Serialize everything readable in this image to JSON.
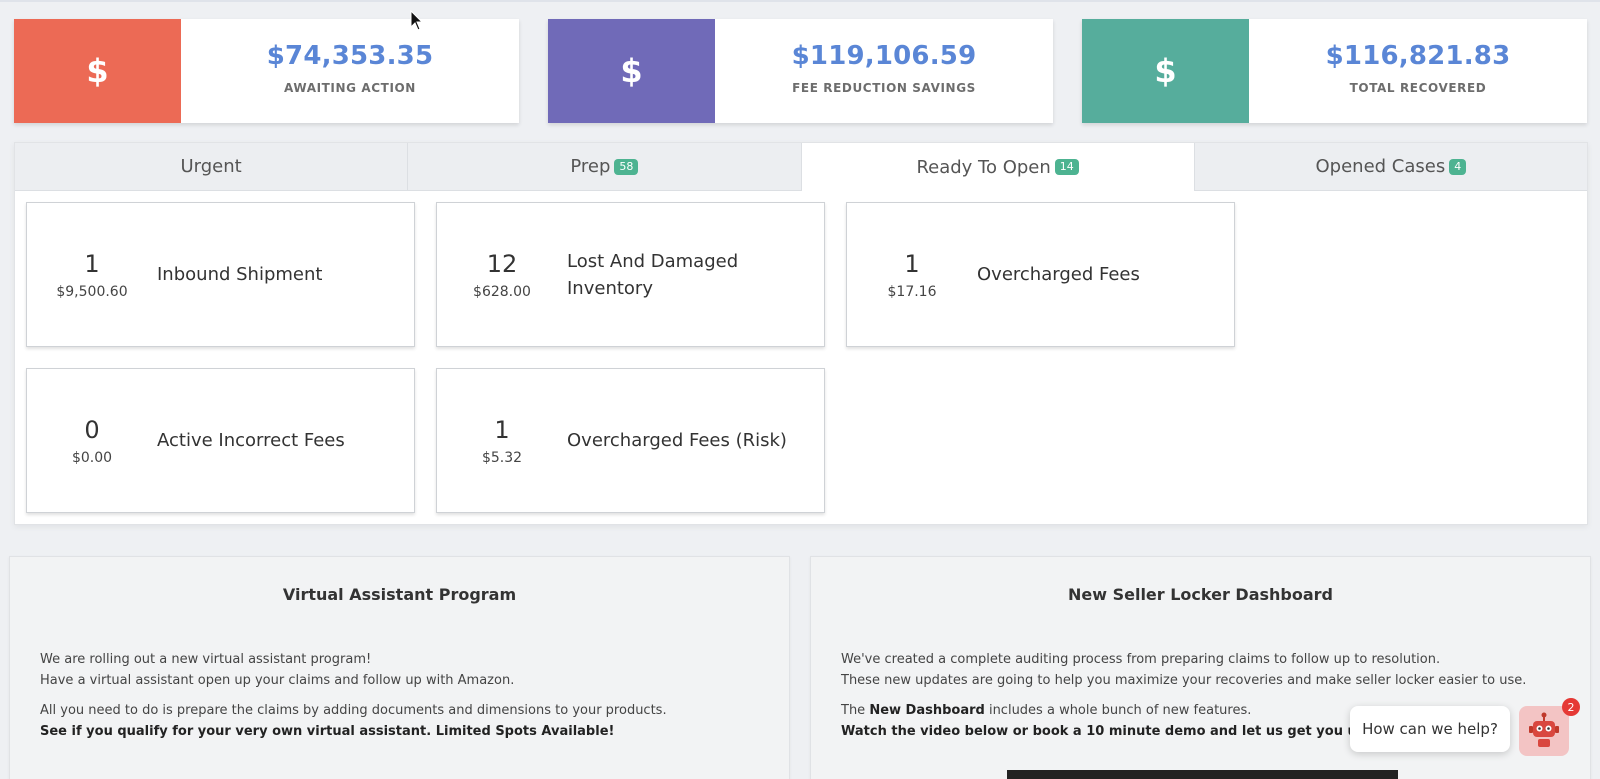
{
  "stats": [
    {
      "amount": "$74,353.35",
      "label": "AWAITING ACTION",
      "icon": "$",
      "color": "#ec6a55"
    },
    {
      "amount": "$119,106.59",
      "label": "FEE REDUCTION SAVINGS",
      "icon": "$",
      "color": "#706ab8"
    },
    {
      "amount": "$116,821.83",
      "label": "TOTAL RECOVERED",
      "icon": "$",
      "color": "#56ad9c"
    }
  ],
  "tabs": [
    {
      "label": "Urgent",
      "badge": ""
    },
    {
      "label": "Prep",
      "badge": "58"
    },
    {
      "label": "Ready To Open",
      "badge": "14"
    },
    {
      "label": "Opened Cases",
      "badge": "4"
    }
  ],
  "active_tab": "Ready To Open",
  "tiles": [
    {
      "count": "1",
      "amount": "$9,500.60",
      "label": "Inbound Shipment"
    },
    {
      "count": "12",
      "amount": "$628.00",
      "label": "Lost And Damaged Inventory"
    },
    {
      "count": "1",
      "amount": "$17.16",
      "label": "Overcharged Fees"
    },
    {
      "count": "0",
      "amount": "$0.00",
      "label": "Active Incorrect Fees"
    },
    {
      "count": "1",
      "amount": "$5.32",
      "label": "Overcharged Fees (Risk)"
    }
  ],
  "info_left": {
    "title": "Virtual Assistant Program",
    "line1": "We are rolling out a new virtual assistant program!",
    "line2": "Have a virtual assistant open up your claims and follow up with Amazon.",
    "line3": "All you need to do is prepare the claims by adding documents and dimensions to your products.",
    "line4": "See if you qualify for your very own virtual assistant. Limited Spots Available!"
  },
  "info_right": {
    "title": "New Seller Locker Dashboard",
    "line1": "We've created a complete auditing process from preparing claims to follow up to resolution.",
    "line2": "These new updates are going to help you maximize your recoveries and make seller locker easier to use.",
    "line3_pre": "The ",
    "line3_bold": "New Dashboard",
    "line3_post": " includes a whole bunch of new features.",
    "line4": "Watch the video below or book a 10 minute demo and let us get you up and running as s"
  },
  "chat": {
    "prompt": "How can we help?",
    "notifications": "2",
    "icon": "robot-icon"
  }
}
